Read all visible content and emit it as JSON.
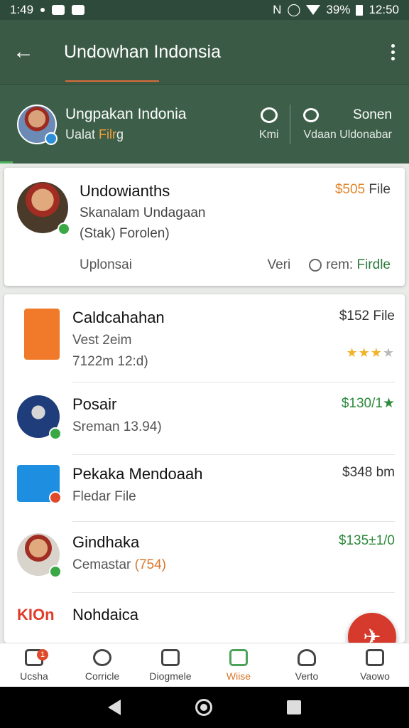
{
  "status_bar": {
    "time_left": "1:49",
    "battery": "39%",
    "time_right": "12:50"
  },
  "app_bar": {
    "title": "Undowhan Indonsia"
  },
  "profile": {
    "name": "Ungpakan Indonia",
    "sub_prefix": "Ualat",
    "sub_highlight": "Filr",
    "sub_suffix": "g",
    "action_label": "Kmi",
    "right_label": "Sonen",
    "right_sub": "Vdaan Uldonabar"
  },
  "featured": {
    "name": "Undowianths",
    "line1": "Skanalam Undagaan",
    "line2": "(Stak) Forolen)",
    "price_amount": "$505",
    "price_unit": "File",
    "footer_left": "Uplonsai",
    "verify": "Veri",
    "find_prefix": "rem:",
    "find_accent": "Firdle"
  },
  "list": [
    {
      "name": "Caldcahahan",
      "line1": "Vest 2eim",
      "line2": "7122m 12:d)",
      "right": "$152 File",
      "rating": 3
    },
    {
      "name": "Posair",
      "line1": "Sreman 13.94)",
      "right": "$130/1★"
    },
    {
      "name": "Pekaka Mendoaah",
      "line1": "Fledar File",
      "right": "$348 bm"
    },
    {
      "name": "Gindhaka",
      "line1_prefix": "Cemastar",
      "line1_accent": "(754)",
      "right": "$135±1/0"
    },
    {
      "name": "Nohdaica",
      "logo_text": "KIOn"
    }
  ],
  "bottom_nav": [
    {
      "label": "Ucsha",
      "badge": "1"
    },
    {
      "label": "Corricle"
    },
    {
      "label": "Diogmele"
    },
    {
      "label": "Wiise"
    },
    {
      "label": "Verto"
    },
    {
      "label": "Vaowo"
    }
  ],
  "colors": {
    "header": "#3b5a46",
    "accent_orange": "#e0862c",
    "accent_green": "#2c8a3c",
    "fab": "#d53a2c"
  }
}
